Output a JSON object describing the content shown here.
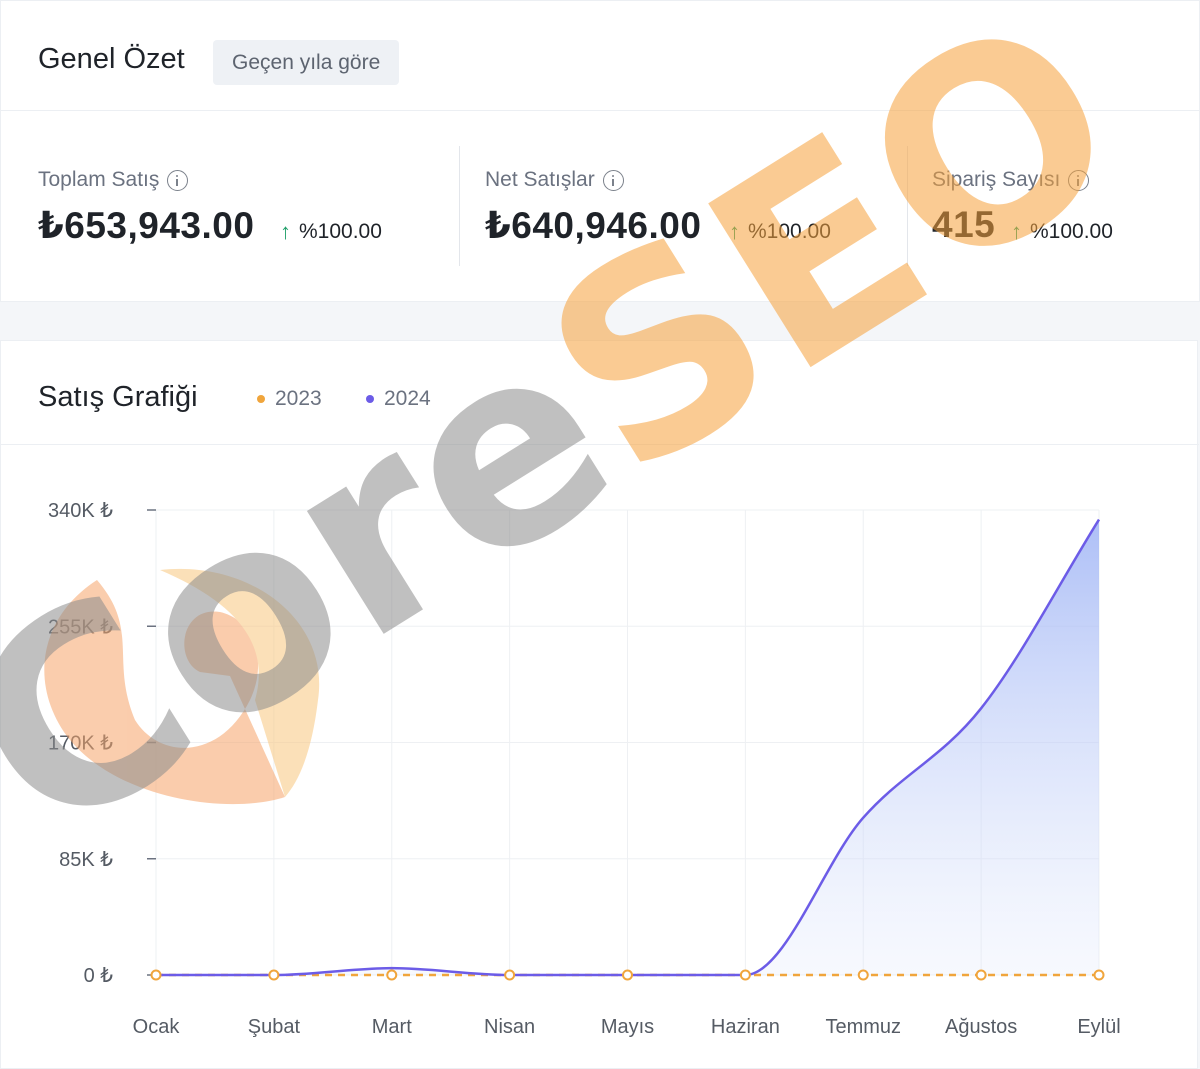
{
  "summary": {
    "title": "Genel Özet",
    "period_badge": "Geçen yıla göre",
    "metrics": [
      {
        "label": "Toplam Satış",
        "value": "₺653,943.00",
        "change": "%100.00"
      },
      {
        "label": "Net Satışlar",
        "value": "₺640,946.00",
        "change": "%100.00"
      },
      {
        "label": "Sipariş Sayısı",
        "value": "415",
        "change": "%100.00"
      }
    ]
  },
  "watermark": {
    "text_dark": "Core",
    "text_accent": "SEO"
  },
  "chart_data": {
    "type": "area",
    "title": "Satış Grafiği",
    "categories": [
      "Ocak",
      "Şubat",
      "Mart",
      "Nisan",
      "Mayıs",
      "Haziran",
      "Temmuz",
      "Ağustos",
      "Eylül"
    ],
    "yticks": [
      0,
      85000,
      170000,
      255000,
      340000
    ],
    "ytick_labels": [
      "0 ₺",
      "85K ₺",
      "170K ₺",
      "255K ₺",
      "340K ₺"
    ],
    "ylim": [
      0,
      340000
    ],
    "grid": true,
    "series": [
      {
        "name": "2023",
        "color": "#f0a53c",
        "style": "dashed",
        "values": [
          0,
          0,
          0,
          0,
          0,
          0,
          0,
          0,
          0
        ]
      },
      {
        "name": "2024",
        "color": "#6c5ce7",
        "style": "area",
        "values": [
          0,
          0,
          5000,
          0,
          0,
          0,
          115000,
          195000,
          333000
        ]
      }
    ]
  }
}
